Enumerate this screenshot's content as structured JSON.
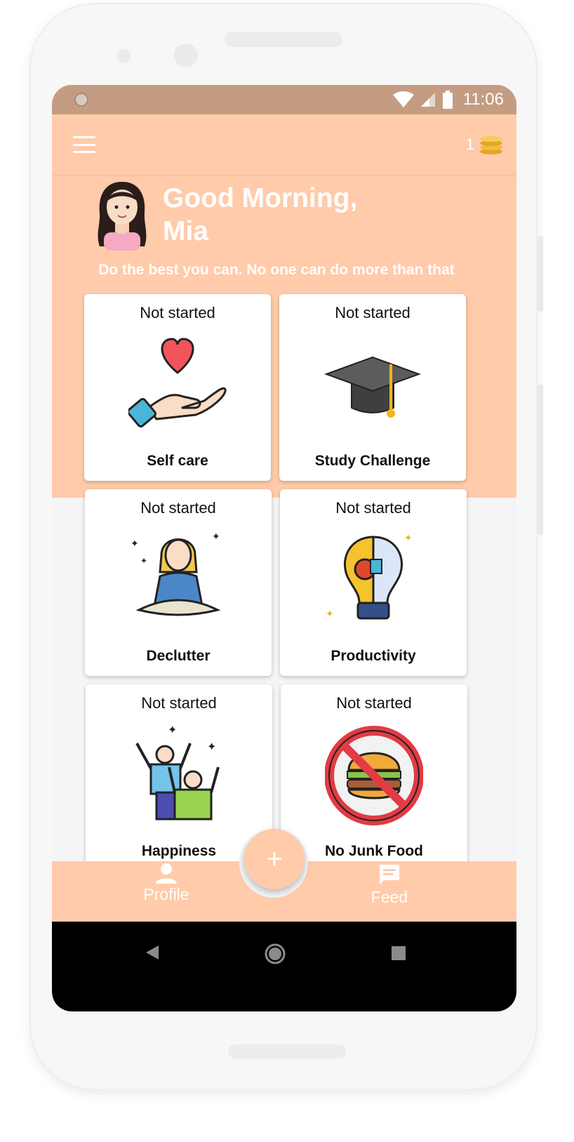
{
  "status_bar": {
    "time": "11:06"
  },
  "app_bar": {
    "coin_count": "1"
  },
  "greeting": {
    "line1": "Good Morning,",
    "line2": "Mia",
    "quote": "Do the best you can. No one can do more than that"
  },
  "challenges": [
    {
      "status": "Not started",
      "title": "Self care",
      "icon": "heart-in-hand-icon"
    },
    {
      "status": "Not started",
      "title": "Study Challenge",
      "icon": "graduation-cap-icon"
    },
    {
      "status": "Not started",
      "title": "Declutter",
      "icon": "meditation-icon"
    },
    {
      "status": "Not started",
      "title": "Productivity",
      "icon": "lightbulb-icon"
    },
    {
      "status": "Not started",
      "title": "Happiness",
      "icon": "happy-people-icon"
    },
    {
      "status": "Not started",
      "title": "No Junk Food",
      "icon": "no-burger-icon"
    }
  ],
  "fab": {
    "label": "+"
  },
  "bottom_nav": {
    "profile": "Profile",
    "feed": "Feed"
  },
  "colors": {
    "primary": "#ffcbaa",
    "status_bar": "#c49c82",
    "background": "#f5f5f5"
  }
}
